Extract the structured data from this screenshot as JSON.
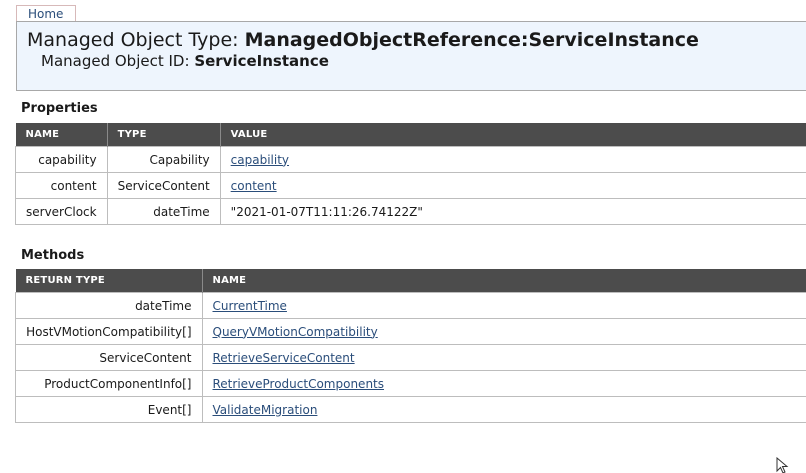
{
  "nav": {
    "home_label": "Home"
  },
  "header": {
    "type_label": "Managed Object Type:",
    "type_value": "ManagedObjectReference:ServiceInstance",
    "id_label": "Managed Object ID:",
    "id_value": "ServiceInstance"
  },
  "properties": {
    "title": "Properties",
    "columns": [
      "NAME",
      "TYPE",
      "VALUE"
    ],
    "rows": [
      {
        "name": "capability",
        "type": "Capability",
        "value": "capability"
      },
      {
        "name": "content",
        "type": "ServiceContent",
        "value": "content"
      },
      {
        "name": "serverClock",
        "type": "dateTime",
        "value": "\"2021-01-07T11:11:26.74122Z\""
      }
    ]
  },
  "methods": {
    "title": "Methods",
    "columns": [
      "RETURN TYPE",
      "NAME"
    ],
    "rows": [
      {
        "return_type": "dateTime",
        "name": "CurrentTime"
      },
      {
        "return_type": "HostVMotionCompatibility[]",
        "name": "QueryVMotionCompatibility"
      },
      {
        "return_type": "ServiceContent",
        "name": "RetrieveServiceContent"
      },
      {
        "return_type": "ProductComponentInfo[]",
        "name": "RetrieveProductComponents"
      },
      {
        "return_type": "Event[]",
        "name": "ValidateMigration"
      }
    ]
  },
  "colors": {
    "header_bg": "#eef5fd",
    "table_header_bg": "#4c4c4c",
    "link": "#2a4d7a"
  }
}
